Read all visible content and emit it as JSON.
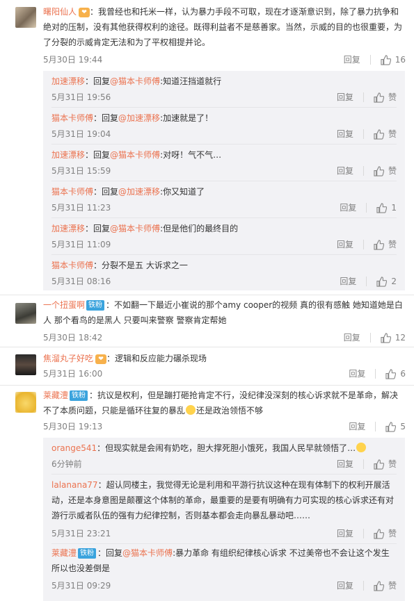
{
  "labels": {
    "reply": "回复",
    "like": "赞",
    "reply_to": "回复"
  },
  "colors": {
    "username": "#eb7350",
    "meta": "#808080",
    "reply_bg": "#f2f2f5",
    "tag_bg": "#3aa3dd"
  },
  "c1": {
    "user": "曙阳仙人",
    "text": "：我曾经也和托米一样，认为暴力手段不可取，现在才逐渐意识到，除了暴力抗争和绝对的压制，没有其他获得权利的途径。既得利益者不是慈善家。当然，示威的目的也很重要，为了分裂的示威肯定无法和为了平权相提并论。",
    "time": "5月30日 19:44",
    "likes": "16",
    "replies": [
      {
        "user": "加速漂移",
        "mention": "@猫本卡师傅",
        "text": ":知道汪挡道就行",
        "time": "5月31日 19:56",
        "likes": "赞"
      },
      {
        "user": "猫本卡师傅",
        "mention": "@加速漂移",
        "text": ":加速就是了！",
        "time": "5月31日 19:04",
        "likes": "赞"
      },
      {
        "user": "加速漂移",
        "mention": "@猫本卡师傅",
        "text": ":对呀！气不气…",
        "time": "5月31日 15:59",
        "likes": "赞"
      },
      {
        "user": "猫本卡师傅",
        "mention": "@加速漂移",
        "text": ":你又知道了",
        "time": "5月31日 11:23",
        "likes": "1"
      },
      {
        "user": "加速漂移",
        "mention": "@猫本卡师傅",
        "text": ":但是他们的最终目的",
        "time": "5月31日 11:09",
        "likes": "赞"
      },
      {
        "user": "猫本卡师傅",
        "mention": "",
        "text": "：分裂不是五 大诉求之一",
        "time": "5月31日 08:16",
        "likes": "2"
      }
    ]
  },
  "c2": {
    "user": "一个扭蛋啊",
    "tag": "铁粉",
    "text": "：不如翻一下最近小崔说的那个amy cooper的视频 真的很有感触 她知道她是白人 那个看鸟的是黑人 只要叫来警察 警察肯定帮她",
    "time": "5月30日 18:42",
    "likes": "12"
  },
  "c3": {
    "user": "焦溜丸子好吃",
    "text": "：逻辑和反应能力碾杀现场",
    "time": "5月31日 16:00",
    "likes": "6"
  },
  "c4": {
    "user": "莱藏澧",
    "tag": "铁粉",
    "text_a": "：抗议是权利，但是蹦打砸抢肯定不行，没纪律没深刻的核心诉求就不是革命，解决不了本质问题，只能是循环往复的暴乱",
    "text_b": "还是政治领悟不够",
    "time": "5月30日 19:13",
    "likes": "5",
    "replies": [
      {
        "user": "orange541",
        "text": "：但现实就是会闹有奶吃，胆大撑死胆小饿死，我国人民早就领悟了…",
        "time": "6分钟前",
        "likes": "赞"
      },
      {
        "user": "lalanana77",
        "text": "：超认同楼主，我觉得无论是利用和平游行抗议这种在现有体制下的权利开展活动，还是本身意图是颠覆这个体制的革命，最重要的是要有明确有力可实现的核心诉求还有对游行示威者队伍的强有力纪律控制，否则基本都会走向暴乱暴动吧……",
        "time": "5月31日 23:21",
        "likes": "赞"
      },
      {
        "user": "莱藏澧",
        "tag": "铁粉",
        "mention": "@猫本卡师傅",
        "text": ":暴力革命 有组织纪律核心诉求 不过美帝也不会让这个发生 所以也没差倒是",
        "time": "5月31日 09:29",
        "likes": "赞"
      }
    ]
  }
}
